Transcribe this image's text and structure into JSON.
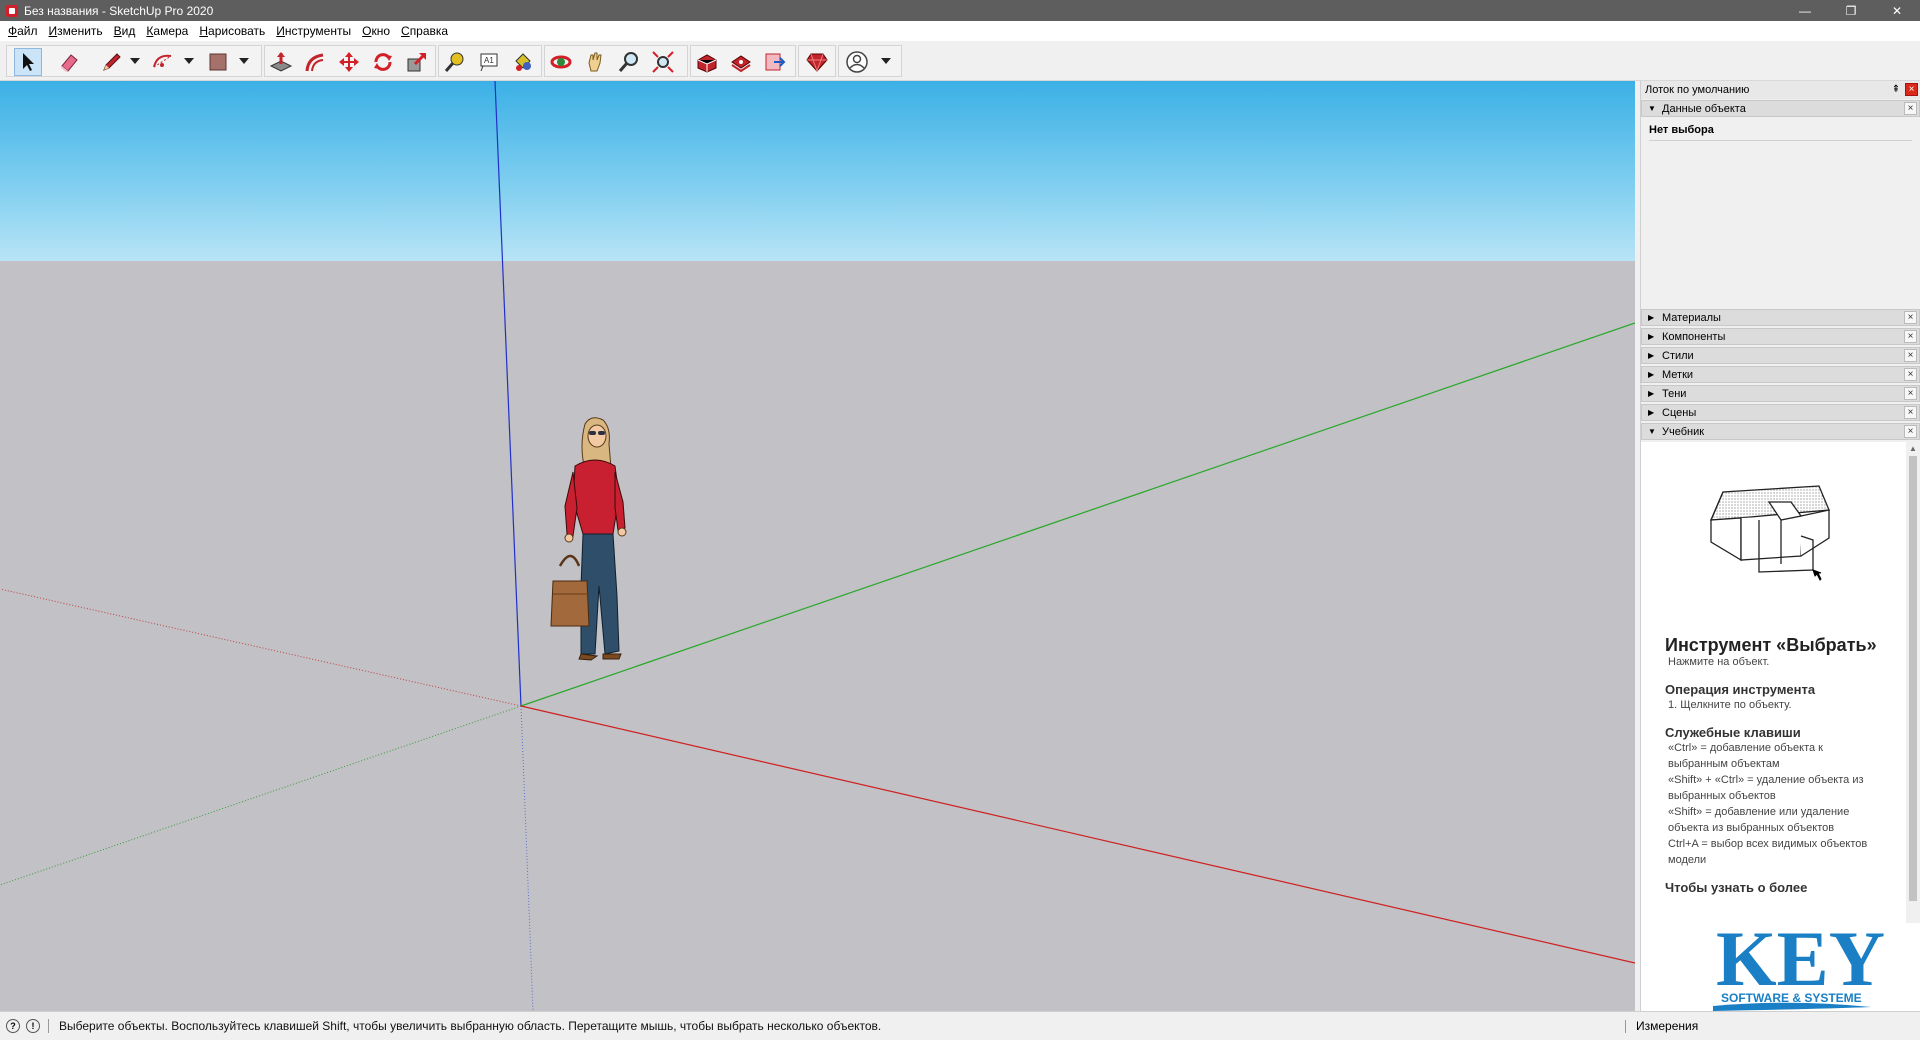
{
  "window": {
    "title": "Без названия - SketchUp Pro 2020",
    "minimize": "—",
    "maximize": "❐",
    "close": "✕"
  },
  "menubar": {
    "items": [
      "Файл",
      "Изменить",
      "Вид",
      "Камера",
      "Нарисовать",
      "Инструменты",
      "Окно",
      "Справка"
    ]
  },
  "toolbar": {
    "tools": [
      {
        "name": "select-tool",
        "icon": "arrow-cursor-icon",
        "active": true
      },
      {
        "name": "eraser-tool",
        "icon": "eraser-icon"
      },
      {
        "name": "line-tool",
        "icon": "pencil-icon",
        "dropdown": true
      },
      {
        "name": "arc-tool",
        "icon": "arc-icon",
        "dropdown": true
      },
      {
        "name": "shape-tool",
        "icon": "rectangle-icon",
        "dropdown": true
      },
      {
        "name": "push-pull-tool",
        "icon": "push-pull-icon"
      },
      {
        "name": "offset-tool",
        "icon": "offset-icon"
      },
      {
        "name": "move-tool",
        "icon": "move-icon"
      },
      {
        "name": "rotate-tool",
        "icon": "rotate-icon"
      },
      {
        "name": "scale-tool",
        "icon": "scale-icon"
      },
      {
        "name": "tape-measure-tool",
        "icon": "tape-measure-icon"
      },
      {
        "name": "text-tool",
        "icon": "text-icon"
      },
      {
        "name": "paint-bucket-tool",
        "icon": "paint-bucket-icon"
      },
      {
        "name": "orbit-tool",
        "icon": "orbit-icon"
      },
      {
        "name": "pan-tool",
        "icon": "hand-icon"
      },
      {
        "name": "zoom-tool",
        "icon": "magnifier-icon"
      },
      {
        "name": "zoom-extents-tool",
        "icon": "zoom-extents-icon"
      },
      {
        "name": "3d-warehouse-tool",
        "icon": "warehouse-icon"
      },
      {
        "name": "extension-warehouse-tool",
        "icon": "extension-warehouse-icon"
      },
      {
        "name": "send-to-layout-tool",
        "icon": "layout-icon"
      },
      {
        "name": "extension-manager-tool",
        "icon": "ruby-gem-icon"
      },
      {
        "name": "account-tool",
        "icon": "user-avatar-icon",
        "dropdown": true
      }
    ]
  },
  "tray": {
    "title": "Лоток по умолчанию",
    "pin": "⇞",
    "close": "×",
    "entity_info": {
      "label": "Данные объекта",
      "no_selection": "Нет выбора"
    },
    "panels": [
      "Материалы",
      "Компоненты",
      "Стили",
      "Метки",
      "Тени",
      "Сцены"
    ],
    "instructor": {
      "label": "Учебник",
      "tool_title": "Инструмент «Выбрать»",
      "tool_desc": "Нажмите на объект.",
      "op_title": "Операция инструмента",
      "op_steps": [
        "1. Щелкните по объекту."
      ],
      "keys_title": "Служебные клавиши",
      "keys_lines": [
        "«Ctrl» = добавление объекта к выбранным объектам",
        "«Shift» + «Ctrl» = удаление объекта из выбранных объектов",
        "«Shift» = добавление или удаление объекта из выбранных объектов",
        "Ctrl+A = выбор всех видимых объектов модели"
      ],
      "more_title": "Чтобы узнать о более"
    }
  },
  "logo": {
    "word": "KEY",
    "tagline": "SOFTWARE & SYSTEME"
  },
  "statusbar": {
    "hint": "Выберите объекты. Воспользуйтесь клавишей Shift, чтобы увеличить выбранную область. Перетащите мышь, чтобы выбрать несколько объектов.",
    "measurements_label": "Измерения"
  },
  "colors": {
    "axis_red": "#d02020",
    "axis_green": "#28a828",
    "axis_blue": "#2030c8",
    "sky": "#5cc0ec",
    "ground": "#c1c1c6",
    "logo_blue": "#1a7fc4"
  }
}
